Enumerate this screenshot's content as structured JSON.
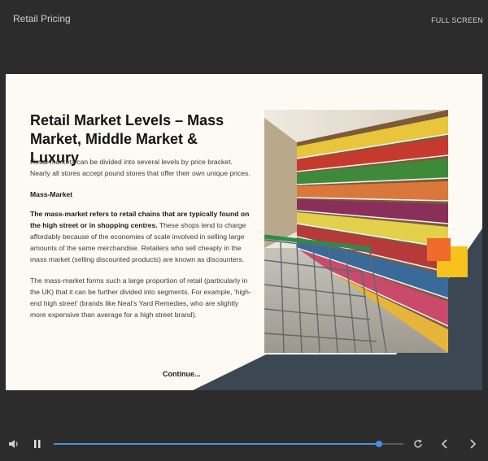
{
  "header": {
    "title": "Retail Pricing",
    "fullscreen_label": "FULL SCREEN"
  },
  "slide": {
    "title": "Retail Market Levels – Mass Market, Middle Market & Luxury",
    "intro": "Retail markets can be divided into several levels by price bracket. Nearly all stores accept pound stores that offer their own unique prices.",
    "section_heading": "Mass-Market",
    "para1_bold": "The mass-market refers to retail chains that are typically found on the high street or in shopping centres.",
    "para1_rest": " These shops tend to charge affordably because of the economies of scale involved in selling large amounts of the same merchandise. Retailers who sell cheaply in the mass market (selling discounted products) are known as discounters.",
    "para2": "The mass-market forms such a large proportion of retail (particularly in the UK) that it can be further divided into segments. For example, ‘high-end high street’ (brands like Neal’s Yard Remedies, who are slightly more expensive than average for a high street brand).",
    "continue_label": "Continue..."
  },
  "player": {
    "progress_fraction": 0.93,
    "accent_color": "#4a90e2"
  },
  "icons": {
    "volume": "volume-icon",
    "pause": "pause-icon",
    "replay": "replay-icon",
    "prev": "chevron-left-icon",
    "next": "chevron-right-icon"
  }
}
